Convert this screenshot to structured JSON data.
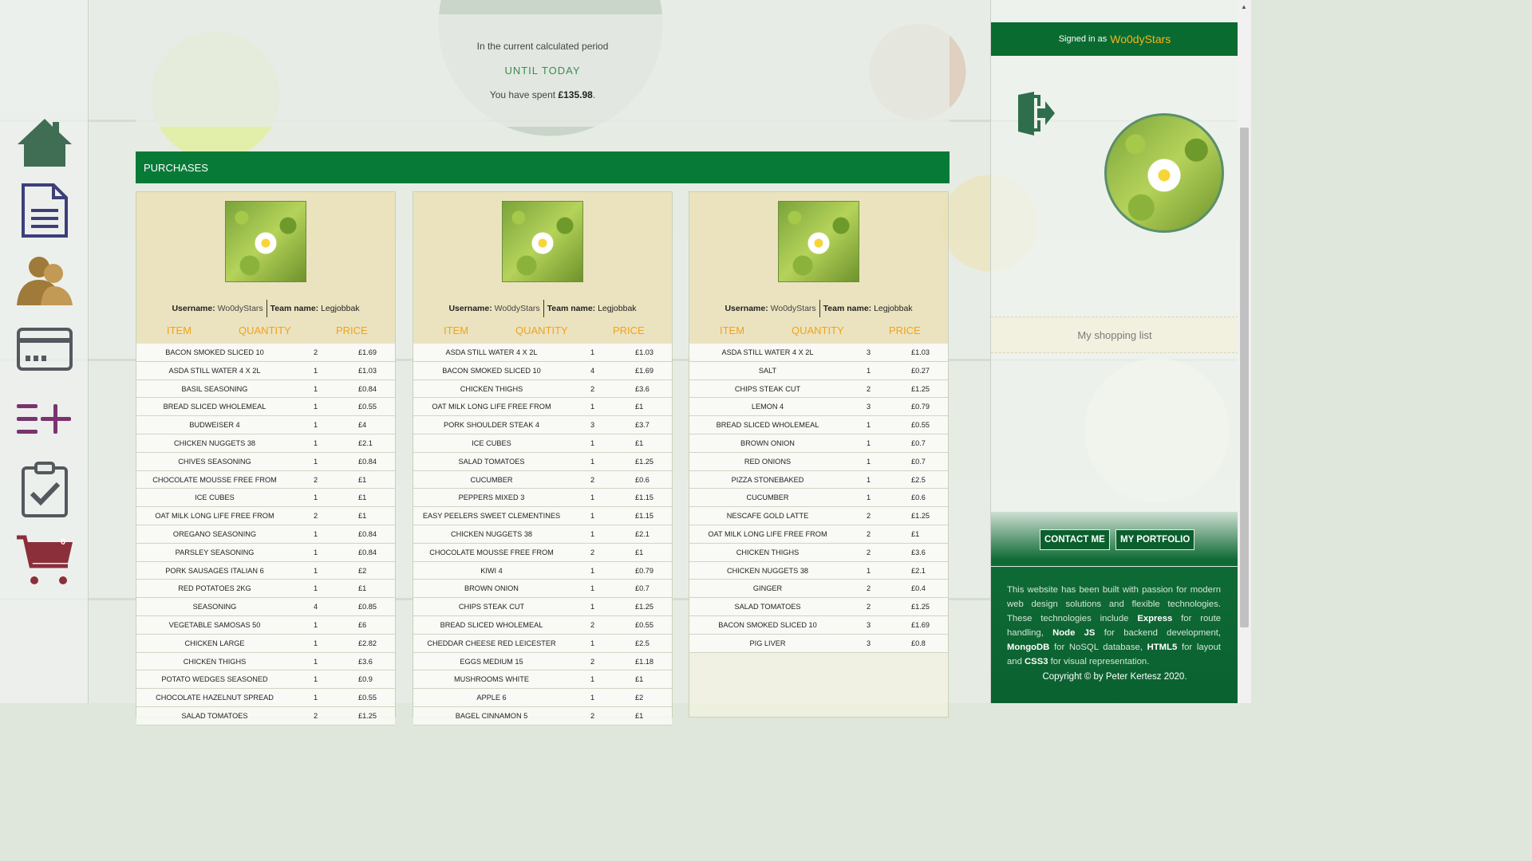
{
  "nav": {
    "cart_count": "0"
  },
  "summary": {
    "line1": "In the current calculated period",
    "line2": "UNTIL TODAY",
    "spent_prefix": "You have spent ",
    "spent_amount": "£135.98",
    "spent_suffix": "."
  },
  "purchases_title": "PURCHASES",
  "card_labels": {
    "username_label": "Username:",
    "team_label": "Team name:",
    "col_item": "ITEM",
    "col_quantity": "QUANTITY",
    "col_price": "PRICE"
  },
  "cards": [
    {
      "username": "Wo0dyStars",
      "team": "Legjobbak",
      "rows": [
        [
          "BACON SMOKED SLICED 10",
          "2",
          "£1.69"
        ],
        [
          "ASDA STILL WATER 4 X 2L",
          "1",
          "£1.03"
        ],
        [
          "BASIL SEASONING",
          "1",
          "£0.84"
        ],
        [
          "BREAD SLICED WHOLEMEAL",
          "1",
          "£0.55"
        ],
        [
          "BUDWEISER 4",
          "1",
          "£4"
        ],
        [
          "CHICKEN NUGGETS 38",
          "1",
          "£2.1"
        ],
        [
          "CHIVES SEASONING",
          "1",
          "£0.84"
        ],
        [
          "CHOCOLATE MOUSSE FREE FROM",
          "2",
          "£1"
        ],
        [
          "ICE CUBES",
          "1",
          "£1"
        ],
        [
          "OAT MILK LONG LIFE FREE FROM",
          "2",
          "£1"
        ],
        [
          "OREGANO SEASONING",
          "1",
          "£0.84"
        ],
        [
          "PARSLEY SEASONING",
          "1",
          "£0.84"
        ],
        [
          "PORK SAUSAGES ITALIAN 6",
          "1",
          "£2"
        ],
        [
          "RED POTATOES 2KG",
          "1",
          "£1"
        ],
        [
          "SEASONING",
          "4",
          "£0.85"
        ],
        [
          "VEGETABLE SAMOSAS 50",
          "1",
          "£6"
        ],
        [
          "CHICKEN LARGE",
          "1",
          "£2.82"
        ],
        [
          "CHICKEN THIGHS",
          "1",
          "£3.6"
        ],
        [
          "POTATO WEDGES SEASONED",
          "1",
          "£0.9"
        ],
        [
          "CHOCOLATE HAZELNUT SPREAD",
          "1",
          "£0.55"
        ],
        [
          "SALAD TOMATOES",
          "2",
          "£1.25"
        ]
      ]
    },
    {
      "username": "Wo0dyStars",
      "team": "Legjobbak",
      "rows": [
        [
          "ASDA STILL WATER 4 X 2L",
          "1",
          "£1.03"
        ],
        [
          "BACON SMOKED SLICED 10",
          "4",
          "£1.69"
        ],
        [
          "CHICKEN THIGHS",
          "2",
          "£3.6"
        ],
        [
          "OAT MILK LONG LIFE FREE FROM",
          "1",
          "£1"
        ],
        [
          "PORK SHOULDER STEAK 4",
          "3",
          "£3.7"
        ],
        [
          "ICE CUBES",
          "1",
          "£1"
        ],
        [
          "SALAD TOMATOES",
          "1",
          "£1.25"
        ],
        [
          "CUCUMBER",
          "2",
          "£0.6"
        ],
        [
          "PEPPERS MIXED 3",
          "1",
          "£1.15"
        ],
        [
          "EASY PEELERS SWEET CLEMENTINES",
          "1",
          "£1.15"
        ],
        [
          "CHICKEN NUGGETS 38",
          "1",
          "£2.1"
        ],
        [
          "CHOCOLATE MOUSSE FREE FROM",
          "2",
          "£1"
        ],
        [
          "KIWI 4",
          "1",
          "£0.79"
        ],
        [
          "BROWN ONION",
          "1",
          "£0.7"
        ],
        [
          "CHIPS STEAK CUT",
          "1",
          "£1.25"
        ],
        [
          "BREAD SLICED WHOLEMEAL",
          "2",
          "£0.55"
        ],
        [
          "CHEDDAR CHEESE RED LEICESTER",
          "1",
          "£2.5"
        ],
        [
          "EGGS MEDIUM 15",
          "2",
          "£1.18"
        ],
        [
          "MUSHROOMS WHITE",
          "1",
          "£1"
        ],
        [
          "APPLE 6",
          "1",
          "£2"
        ],
        [
          "BAGEL CINNAMON 5",
          "2",
          "£1"
        ]
      ]
    },
    {
      "username": "Wo0dyStars",
      "team": "Legjobbak",
      "rows": [
        [
          "ASDA STILL WATER 4 X 2L",
          "3",
          "£1.03"
        ],
        [
          "SALT",
          "1",
          "£0.27"
        ],
        [
          "CHIPS STEAK CUT",
          "2",
          "£1.25"
        ],
        [
          "LEMON 4",
          "3",
          "£0.79"
        ],
        [
          "BREAD SLICED WHOLEMEAL",
          "1",
          "£0.55"
        ],
        [
          "BROWN ONION",
          "1",
          "£0.7"
        ],
        [
          "RED ONIONS",
          "1",
          "£0.7"
        ],
        [
          "PIZZA STONEBAKED",
          "1",
          "£2.5"
        ],
        [
          "CUCUMBER",
          "1",
          "£0.6"
        ],
        [
          "NESCAFE GOLD LATTE",
          "2",
          "£1.25"
        ],
        [
          "OAT MILK LONG LIFE FREE FROM",
          "2",
          "£1"
        ],
        [
          "CHICKEN THIGHS",
          "2",
          "£3.6"
        ],
        [
          "CHICKEN NUGGETS 38",
          "1",
          "£2.1"
        ],
        [
          "GINGER",
          "2",
          "£0.4"
        ],
        [
          "SALAD TOMATOES",
          "2",
          "£1.25"
        ],
        [
          "BACON SMOKED SLICED 10",
          "3",
          "£1.69"
        ],
        [
          "PIG LIVER",
          "3",
          "£0.8"
        ]
      ]
    }
  ],
  "sidebar": {
    "signed_prefix": "Signed in as",
    "signed_user": "Wo0dyStars",
    "shopping_list": "My shopping list",
    "contact_btn": "CONTACT ME",
    "portfolio_btn": "MY PORTFOLIO",
    "about": {
      "t1": "This website has been built with passion for modern web design solutions and flexible technologies. These technologies include ",
      "b1": "Express",
      "t2": " for route handling, ",
      "b2": "Node JS",
      "t3": " for backend development, ",
      "b3": "MongoDB",
      "t4": " for NoSQL database, ",
      "b4": "HTML5",
      "t5": " for layout and ",
      "b5": "CSS3",
      "t6": " for visual representation."
    },
    "copyright": "Copyright © by Peter Kertesz 2020."
  },
  "colors": {
    "brand_green": "#087a38",
    "accent_orange": "#f3a21a",
    "signed_name": "#f4b51d"
  },
  "icons": [
    "home-icon",
    "document-icon",
    "users-icon",
    "credit-card-icon",
    "add-list-icon",
    "clipboard-check-icon",
    "cart-icon",
    "logout-icon"
  ]
}
